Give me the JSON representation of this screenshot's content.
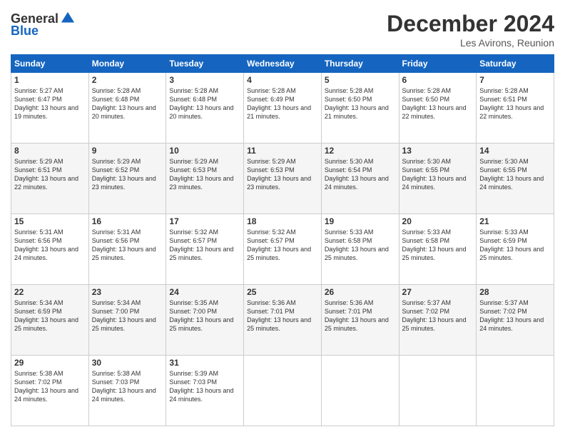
{
  "header": {
    "logo_line1": "General",
    "logo_line2": "Blue",
    "month": "December 2024",
    "location": "Les Avirons, Reunion"
  },
  "weekdays": [
    "Sunday",
    "Monday",
    "Tuesday",
    "Wednesday",
    "Thursday",
    "Friday",
    "Saturday"
  ],
  "weeks": [
    [
      {
        "day": "1",
        "rise": "5:27 AM",
        "set": "6:47 PM",
        "daylight": "13 hours and 19 minutes."
      },
      {
        "day": "2",
        "rise": "5:28 AM",
        "set": "6:48 PM",
        "daylight": "13 hours and 20 minutes."
      },
      {
        "day": "3",
        "rise": "5:28 AM",
        "set": "6:48 PM",
        "daylight": "13 hours and 20 minutes."
      },
      {
        "day": "4",
        "rise": "5:28 AM",
        "set": "6:49 PM",
        "daylight": "13 hours and 21 minutes."
      },
      {
        "day": "5",
        "rise": "5:28 AM",
        "set": "6:50 PM",
        "daylight": "13 hours and 21 minutes."
      },
      {
        "day": "6",
        "rise": "5:28 AM",
        "set": "6:50 PM",
        "daylight": "13 hours and 22 minutes."
      },
      {
        "day": "7",
        "rise": "5:28 AM",
        "set": "6:51 PM",
        "daylight": "13 hours and 22 minutes."
      }
    ],
    [
      {
        "day": "8",
        "rise": "5:29 AM",
        "set": "6:51 PM",
        "daylight": "13 hours and 22 minutes."
      },
      {
        "day": "9",
        "rise": "5:29 AM",
        "set": "6:52 PM",
        "daylight": "13 hours and 23 minutes."
      },
      {
        "day": "10",
        "rise": "5:29 AM",
        "set": "6:53 PM",
        "daylight": "13 hours and 23 minutes."
      },
      {
        "day": "11",
        "rise": "5:29 AM",
        "set": "6:53 PM",
        "daylight": "13 hours and 23 minutes."
      },
      {
        "day": "12",
        "rise": "5:30 AM",
        "set": "6:54 PM",
        "daylight": "13 hours and 24 minutes."
      },
      {
        "day": "13",
        "rise": "5:30 AM",
        "set": "6:55 PM",
        "daylight": "13 hours and 24 minutes."
      },
      {
        "day": "14",
        "rise": "5:30 AM",
        "set": "6:55 PM",
        "daylight": "13 hours and 24 minutes."
      }
    ],
    [
      {
        "day": "15",
        "rise": "5:31 AM",
        "set": "6:56 PM",
        "daylight": "13 hours and 24 minutes."
      },
      {
        "day": "16",
        "rise": "5:31 AM",
        "set": "6:56 PM",
        "daylight": "13 hours and 25 minutes."
      },
      {
        "day": "17",
        "rise": "5:32 AM",
        "set": "6:57 PM",
        "daylight": "13 hours and 25 minutes."
      },
      {
        "day": "18",
        "rise": "5:32 AM",
        "set": "6:57 PM",
        "daylight": "13 hours and 25 minutes."
      },
      {
        "day": "19",
        "rise": "5:33 AM",
        "set": "6:58 PM",
        "daylight": "13 hours and 25 minutes."
      },
      {
        "day": "20",
        "rise": "5:33 AM",
        "set": "6:58 PM",
        "daylight": "13 hours and 25 minutes."
      },
      {
        "day": "21",
        "rise": "5:33 AM",
        "set": "6:59 PM",
        "daylight": "13 hours and 25 minutes."
      }
    ],
    [
      {
        "day": "22",
        "rise": "5:34 AM",
        "set": "6:59 PM",
        "daylight": "13 hours and 25 minutes."
      },
      {
        "day": "23",
        "rise": "5:34 AM",
        "set": "7:00 PM",
        "daylight": "13 hours and 25 minutes."
      },
      {
        "day": "24",
        "rise": "5:35 AM",
        "set": "7:00 PM",
        "daylight": "13 hours and 25 minutes."
      },
      {
        "day": "25",
        "rise": "5:36 AM",
        "set": "7:01 PM",
        "daylight": "13 hours and 25 minutes."
      },
      {
        "day": "26",
        "rise": "5:36 AM",
        "set": "7:01 PM",
        "daylight": "13 hours and 25 minutes."
      },
      {
        "day": "27",
        "rise": "5:37 AM",
        "set": "7:02 PM",
        "daylight": "13 hours and 25 minutes."
      },
      {
        "day": "28",
        "rise": "5:37 AM",
        "set": "7:02 PM",
        "daylight": "13 hours and 24 minutes."
      }
    ],
    [
      {
        "day": "29",
        "rise": "5:38 AM",
        "set": "7:02 PM",
        "daylight": "13 hours and 24 minutes."
      },
      {
        "day": "30",
        "rise": "5:38 AM",
        "set": "7:03 PM",
        "daylight": "13 hours and 24 minutes."
      },
      {
        "day": "31",
        "rise": "5:39 AM",
        "set": "7:03 PM",
        "daylight": "13 hours and 24 minutes."
      },
      null,
      null,
      null,
      null
    ]
  ]
}
